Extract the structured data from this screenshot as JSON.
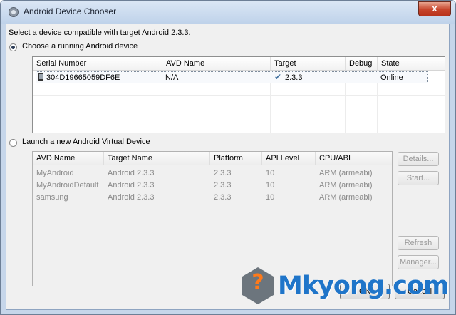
{
  "window": {
    "title": "Android Device Chooser",
    "close_label": "x",
    "icon": "gear-icon"
  },
  "prompt": "Select a device compatible with target Android 2.3.3.",
  "running": {
    "option_label": "Choose a running Android device",
    "selected": true,
    "columns": [
      "Serial Number",
      "AVD Name",
      "Target",
      "Debug",
      "State"
    ],
    "rows": [
      {
        "serial": "304D19665059DF6E",
        "avd": "N/A",
        "target": "2.3.3",
        "debug": "",
        "state": "Online",
        "device_icon": "phone-icon",
        "target_icon": "checkmark-icon"
      }
    ]
  },
  "launch": {
    "option_label": "Launch a new Android Virtual Device",
    "selected": false,
    "columns": [
      "AVD Name",
      "Target Name",
      "Platform",
      "API Level",
      "CPU/ABI"
    ],
    "rows": [
      {
        "avd": "MyAndroid",
        "target": "Android 2.3.3",
        "platform": "2.3.3",
        "api": "10",
        "cpu": "ARM (armeabi)"
      },
      {
        "avd": "MyAndroidDefault",
        "target": "Android 2.3.3",
        "platform": "2.3.3",
        "api": "10",
        "cpu": "ARM (armeabi)"
      },
      {
        "avd": "samsung",
        "target": "Android 2.3.3",
        "platform": "2.3.3",
        "api": "10",
        "cpu": "ARM (armeabi)"
      }
    ],
    "buttons": {
      "details": "Details...",
      "start": "Start...",
      "refresh": "Refresh",
      "manager": "Manager..."
    }
  },
  "footer": {
    "ok": "OK",
    "cancel": "Cancel"
  },
  "watermark": {
    "text": "Mkyong.com",
    "glyph": "?"
  },
  "colors": {
    "title_bar": "#c6d6ea",
    "selection": "#1f75c9",
    "watermark_accent": "#ff7a1a"
  }
}
